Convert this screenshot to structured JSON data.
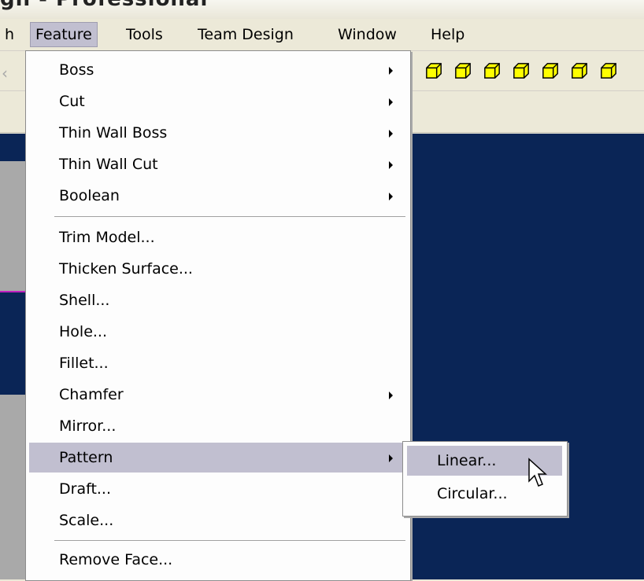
{
  "window": {
    "title": "gn - Professional"
  },
  "menubar": {
    "items": [
      {
        "label": "h"
      },
      {
        "label": "Feature"
      },
      {
        "label": "Tools"
      },
      {
        "label": "Team Design"
      },
      {
        "label": "Window"
      },
      {
        "label": "Help"
      }
    ]
  },
  "feature_menu": {
    "items": [
      {
        "label": "Boss",
        "submenu": true
      },
      {
        "label": "Cut",
        "submenu": true
      },
      {
        "label": "Thin Wall Boss",
        "submenu": true
      },
      {
        "label": "Thin Wall Cut",
        "submenu": true
      },
      {
        "label": "Boolean",
        "submenu": true
      },
      {
        "label": "Trim Model...",
        "submenu": false
      },
      {
        "label": "Thicken Surface...",
        "submenu": false
      },
      {
        "label": "Shell...",
        "submenu": false
      },
      {
        "label": "Hole...",
        "submenu": false
      },
      {
        "label": "Fillet...",
        "submenu": false
      },
      {
        "label": "Chamfer",
        "submenu": true
      },
      {
        "label": "Mirror...",
        "submenu": false
      },
      {
        "label": "Pattern",
        "submenu": true,
        "highlighted": true
      },
      {
        "label": "Draft...",
        "submenu": false
      },
      {
        "label": "Scale...",
        "submenu": false
      },
      {
        "label": "Remove Face...",
        "submenu": false
      }
    ]
  },
  "pattern_submenu": {
    "items": [
      {
        "label": "Linear...",
        "highlighted": true
      },
      {
        "label": "Circular..."
      }
    ]
  },
  "toolbar": {
    "icons": [
      "view-cube-icon",
      "view-cube-icon",
      "view-cube-icon",
      "view-cube-icon",
      "view-cube-icon",
      "view-cube-icon",
      "view-cube-icon"
    ]
  },
  "colors": {
    "menu_highlight": "#c1bfd0",
    "viewport_bg": "#0a2556",
    "model_face": "#a9a9a9",
    "icon_fill": "#ffff00"
  }
}
